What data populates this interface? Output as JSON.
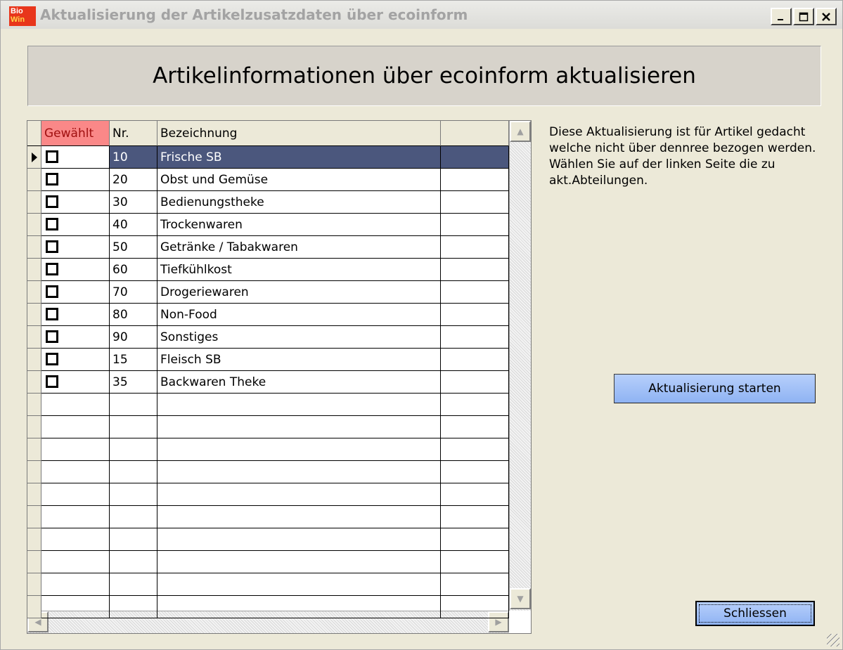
{
  "window": {
    "title": "Aktualisierung der Artikelzusatzdaten über ecoinform",
    "icon_line1": "Bio",
    "icon_line2": "Win",
    "buttons": [
      "minimize-icon",
      "maximize-icon",
      "close-icon"
    ]
  },
  "header": {
    "title": "Artikelinformationen über ecoinform aktualisieren"
  },
  "grid": {
    "columns": [
      "Gewählt",
      "Nr.",
      "Bezeichnung",
      ""
    ],
    "selected_column": "Gewählt",
    "rows": [
      {
        "checked": false,
        "nr": "10",
        "name": "Frische SB",
        "extra": ""
      },
      {
        "checked": false,
        "nr": "20",
        "name": "Obst und Gemüse",
        "extra": ""
      },
      {
        "checked": false,
        "nr": "30",
        "name": "Bedienungstheke",
        "extra": ""
      },
      {
        "checked": false,
        "nr": "40",
        "name": "Trockenwaren",
        "extra": ""
      },
      {
        "checked": false,
        "nr": "50",
        "name": "Getränke / Tabakwaren",
        "extra": ""
      },
      {
        "checked": false,
        "nr": "60",
        "name": "Tiefkühlkost",
        "extra": ""
      },
      {
        "checked": false,
        "nr": "70",
        "name": "Drogeriewaren",
        "extra": ""
      },
      {
        "checked": false,
        "nr": "80",
        "name": "Non-Food",
        "extra": ""
      },
      {
        "checked": false,
        "nr": "90",
        "name": "Sonstiges",
        "extra": ""
      },
      {
        "checked": false,
        "nr": "15",
        "name": "Fleisch SB",
        "extra": ""
      },
      {
        "checked": false,
        "nr": "35",
        "name": "Backwaren  Theke",
        "extra": ""
      }
    ],
    "selected_row": 0,
    "empty_rows": 10
  },
  "info": {
    "text": "Diese Aktualisierung ist für Artikel gedacht welche nicht über dennree bezogen werden. Wählen Sie auf der linken Seite die zu akt.Abteilungen."
  },
  "actions": {
    "start_label": "Aktualisierung starten",
    "close_label": "Schliessen"
  },
  "colors": {
    "selected_row": "#4b577d",
    "selected_header": "#fa8888",
    "button": "#a6c2f7"
  }
}
